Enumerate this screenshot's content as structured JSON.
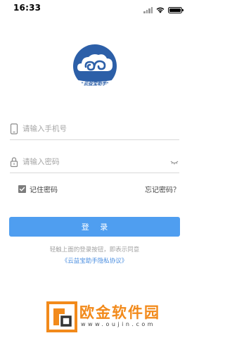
{
  "status_bar": {
    "time": "16:33",
    "icons": [
      "signal-icon",
      "wifi-icon",
      "battery-icon"
    ]
  },
  "logo": {
    "text": "\"云益宝助手\"",
    "colors": {
      "circle": "#2c5fa8",
      "cloud": "#ffffff",
      "banner_text": "#2c5fa8"
    }
  },
  "form": {
    "phone": {
      "placeholder": "请输入手机号",
      "value": "",
      "icon": "phone-icon"
    },
    "password": {
      "placeholder": "请输入密码",
      "value": "",
      "icon": "lock-icon",
      "toggle_icon": "eye-closed-icon"
    },
    "remember_label": "记住密码",
    "remember_checked": true,
    "forgot_label": "忘记密码？",
    "login_label": "登 录"
  },
  "agreement": {
    "text": "轻触上面的登录按钮，即表示同意",
    "link": "《云益宝助手隐私协议》"
  },
  "watermark": {
    "title": "欧金软件园",
    "url": "www.oujin.com"
  },
  "colors": {
    "accent": "#4f9ef0",
    "link": "#4a8ee0",
    "watermark": "#f28a1b"
  }
}
